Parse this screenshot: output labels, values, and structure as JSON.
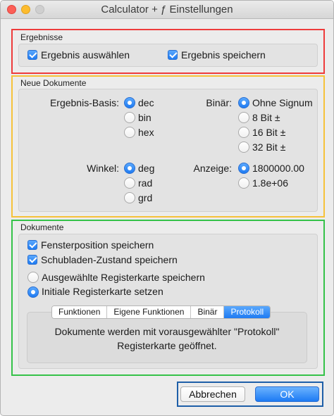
{
  "window": {
    "title": "Calculator + ƒ Einstellungen"
  },
  "ergebnisse": {
    "label": "Ergebnisse",
    "select_result": {
      "label": "Ergebnis auswählen",
      "checked": true
    },
    "save_result": {
      "label": "Ergebnis speichern",
      "checked": true
    }
  },
  "neue_dokumente": {
    "label": "Neue Dokumente",
    "basis": {
      "label": "Ergebnis-Basis:",
      "options": [
        "dec",
        "bin",
        "hex"
      ],
      "selected": "dec"
    },
    "binaer": {
      "label": "Binär:",
      "options": [
        "Ohne Signum",
        "8 Bit ±",
        "16 Bit ±",
        "32 Bit ±"
      ],
      "selected": "Ohne Signum"
    },
    "winkel": {
      "label": "Winkel:",
      "options": [
        "deg",
        "rad",
        "grd"
      ],
      "selected": "deg"
    },
    "anzeige": {
      "label": "Anzeige:",
      "options": [
        "1800000.00",
        "1.8e+06"
      ],
      "selected": "1800000.00"
    }
  },
  "dokumente": {
    "label": "Dokumente",
    "window_position": {
      "label": "Fensterposition speichern",
      "checked": true
    },
    "drawer_state": {
      "label": "Schubladen-Zustand speichern",
      "checked": true
    },
    "tab_options": [
      {
        "label": "Ausgewählte Registerkarte speichern",
        "selected": false
      },
      {
        "label": "Initiale Registerkarte setzen",
        "selected": true
      }
    ],
    "tabs": [
      "Funktionen",
      "Eigene Funktionen",
      "Binär",
      "Protokoll"
    ],
    "active_tab": "Protokoll",
    "tab_message_line1": "Dokumente werden mit vorausgewählter \"Protokoll\"",
    "tab_message_line2": "Registerkarte geöffnet."
  },
  "buttons": {
    "cancel": "Abbrechen",
    "ok": "OK"
  },
  "colors": {
    "accent": "#1f7bf2",
    "outline_red": "#ee3b3b",
    "outline_yellow": "#f6c23a",
    "outline_green": "#35c249",
    "outline_blue": "#1e5fa8"
  }
}
